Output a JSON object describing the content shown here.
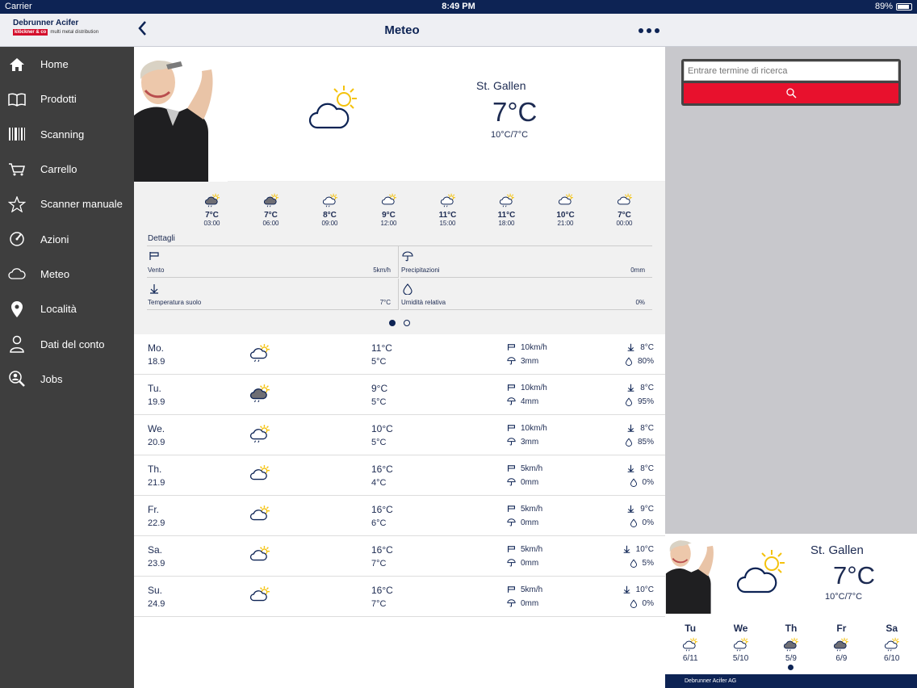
{
  "status": {
    "carrier": "Carrier",
    "time": "8:49 PM",
    "battery": "89%",
    "battery_level": 0.89
  },
  "header": {
    "brand": "Debrunner Acifer",
    "brand_badge": "klöckner & co",
    "brand_sub": "multi metal distribution",
    "title": "Meteo",
    "back_icon": "chevron-left-icon",
    "more_icon": "ellipsis-icon"
  },
  "sidebar": {
    "items": [
      {
        "label": "Home",
        "icon": "home-icon"
      },
      {
        "label": "Prodotti",
        "icon": "book-icon"
      },
      {
        "label": "Scanning",
        "icon": "barcode-icon"
      },
      {
        "label": "Carrello",
        "icon": "cart-icon"
      },
      {
        "label": "Scanner manuale",
        "icon": "star-icon"
      },
      {
        "label": "Azioni",
        "icon": "gauge-icon"
      },
      {
        "label": "Meteo",
        "icon": "cloud-icon"
      },
      {
        "label": "Località",
        "icon": "location-pin-icon"
      },
      {
        "label": "Dati del conto",
        "icon": "user-icon"
      },
      {
        "label": "Jobs",
        "icon": "search-person-icon"
      }
    ]
  },
  "current": {
    "city": "St. Gallen",
    "temp": "7°C",
    "range": "10°C/7°C"
  },
  "hourly": [
    {
      "temp": "7°C",
      "time": "03:00",
      "icon": "rain-cloud"
    },
    {
      "temp": "7°C",
      "time": "06:00",
      "icon": "rain-cloud"
    },
    {
      "temp": "8°C",
      "time": "09:00",
      "icon": "sun-rain"
    },
    {
      "temp": "9°C",
      "time": "12:00",
      "icon": "sun-cloud"
    },
    {
      "temp": "11°C",
      "time": "15:00",
      "icon": "sun-rain"
    },
    {
      "temp": "11°C",
      "time": "18:00",
      "icon": "sun-rain"
    },
    {
      "temp": "10°C",
      "time": "21:00",
      "icon": "sun-cloud"
    },
    {
      "temp": "7°C",
      "time": "00:00",
      "icon": "sun-cloud"
    }
  ],
  "details": {
    "title": "Dettagli",
    "wind_label": "Vento",
    "wind": "5km/h",
    "precip_label": "Precipitazioni",
    "precip": "0mm",
    "soil_label": "Temperatura suolo",
    "soil": "7°C",
    "humidity_label": "Umidità relativa",
    "humidity": "0%"
  },
  "daily": [
    {
      "day": "Mo.",
      "date": "18.9",
      "tmax": "11°C",
      "tmin": "5°C",
      "wind": "10km/h",
      "rain": "3mm",
      "soil": "8°C",
      "hum": "80%",
      "icon": "sun-rain"
    },
    {
      "day": "Tu.",
      "date": "19.9",
      "tmax": "9°C",
      "tmin": "5°C",
      "wind": "10km/h",
      "rain": "4mm",
      "soil": "8°C",
      "hum": "95%",
      "icon": "rain-cloud"
    },
    {
      "day": "We.",
      "date": "20.9",
      "tmax": "10°C",
      "tmin": "5°C",
      "wind": "10km/h",
      "rain": "3mm",
      "soil": "8°C",
      "hum": "85%",
      "icon": "sun-rain"
    },
    {
      "day": "Th.",
      "date": "21.9",
      "tmax": "16°C",
      "tmin": "4°C",
      "wind": "5km/h",
      "rain": "0mm",
      "soil": "8°C",
      "hum": "0%",
      "icon": "sun-cloud"
    },
    {
      "day": "Fr.",
      "date": "22.9",
      "tmax": "16°C",
      "tmin": "6°C",
      "wind": "5km/h",
      "rain": "0mm",
      "soil": "9°C",
      "hum": "0%",
      "icon": "sun-cloud"
    },
    {
      "day": "Sa.",
      "date": "23.9",
      "tmax": "16°C",
      "tmin": "7°C",
      "wind": "5km/h",
      "rain": "0mm",
      "soil": "10°C",
      "hum": "5%",
      "icon": "sun-cloud"
    },
    {
      "day": "Su.",
      "date": "24.9",
      "tmax": "16°C",
      "tmin": "7°C",
      "wind": "5km/h",
      "rain": "0mm",
      "soil": "10°C",
      "hum": "0%",
      "icon": "sun-cloud"
    }
  ],
  "search": {
    "placeholder": "Entrare termine di ricerca",
    "button_icon": "search-icon"
  },
  "widget": {
    "city": "St. Gallen",
    "temp": "7°C",
    "range": "10°C/7°C",
    "footer": "Debrunner Acifer AG",
    "days": [
      {
        "day": "Tu",
        "range": "6/11",
        "icon": "sun-rain"
      },
      {
        "day": "We",
        "range": "5/10",
        "icon": "sun-rain"
      },
      {
        "day": "Th",
        "range": "5/9",
        "icon": "rain-cloud"
      },
      {
        "day": "Fr",
        "range": "6/9",
        "icon": "rain-cloud"
      },
      {
        "day": "Sa",
        "range": "6/10",
        "icon": "sun-rain"
      }
    ]
  },
  "colors": {
    "navy": "#0d2354",
    "sidebar": "#3e3e3e",
    "accent_red": "#e8112d",
    "sun": "#f4c20d"
  }
}
